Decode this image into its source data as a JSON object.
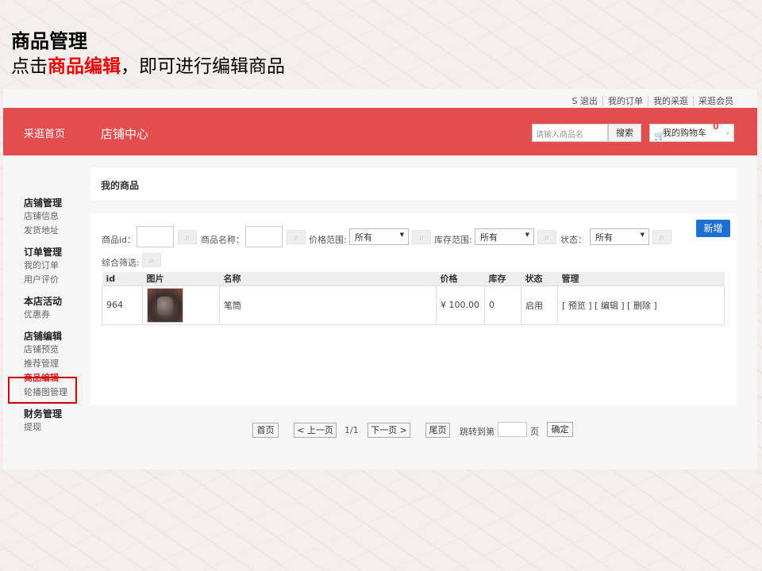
{
  "slide": {
    "title": "商品管理",
    "sub_prefix": "点击",
    "sub_highlight": "商品编辑",
    "sub_suffix": "，即可进行编辑商品"
  },
  "toplinks": [
    "S 退出",
    "我的订单",
    "我的采逛",
    "采逛会员"
  ],
  "header": {
    "home": "采逛首页",
    "center": "店铺中心",
    "search_placeholder": "请输入商品名",
    "search_btn": "搜索",
    "cart_label": "我的购物车",
    "cart_count": "0"
  },
  "sidebar": [
    {
      "group": "店铺管理",
      "items": [
        "店铺信息",
        "发货地址"
      ]
    },
    {
      "group": "订单管理",
      "items": [
        "我的订单",
        "用户评价"
      ]
    },
    {
      "group": "本店活动",
      "items": [
        "优惠券"
      ]
    },
    {
      "group": "店铺编辑",
      "items": [
        "店铺预览",
        "推荐管理",
        "商品编辑",
        "轮播图管理"
      ]
    },
    {
      "group": "财务管理",
      "items": [
        "提现"
      ]
    }
  ],
  "panel_title": "我的商品",
  "filters": {
    "id_label": "商品id：",
    "name_label": "商品名称：",
    "price_label": "价格范围:",
    "price_value": "所有",
    "stock_label": "库存范围:",
    "stock_value": "所有",
    "status_label": "状态：",
    "status_value": "所有",
    "combo_label": "综合筛选:",
    "new_btn": "新增"
  },
  "table": {
    "headers": [
      "id",
      "图片",
      "名称",
      "价格",
      "库存",
      "状态",
      "管理"
    ],
    "rows": [
      {
        "id": "964",
        "name": "笔筒",
        "price": "¥ 100.00",
        "stock": "0",
        "status": "启用",
        "actions": "[ 预览 ] [ 编辑 ] [ 删除 ]"
      }
    ]
  },
  "pager": {
    "first": "首页",
    "prev": "< 上一页",
    "info": "1/1",
    "next": "下一页 >",
    "last": "尾页",
    "jump": "跳转到第",
    "page": "页",
    "confirm": "确定"
  }
}
